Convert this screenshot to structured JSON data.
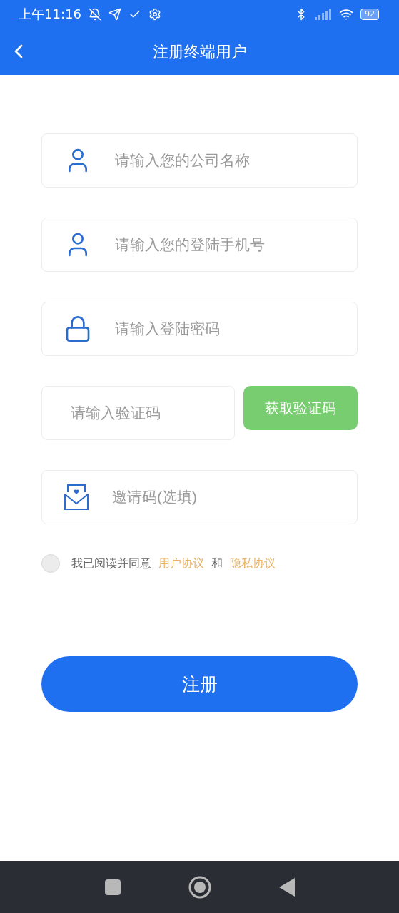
{
  "status_bar": {
    "time": "上午11:16",
    "battery": "92"
  },
  "nav": {
    "title": "注册终端用户"
  },
  "fields": [
    {
      "kind": "person",
      "placeholder": "请输入您的公司名称"
    },
    {
      "kind": "person",
      "placeholder": "请输入您的登陆手机号"
    },
    {
      "kind": "lock",
      "placeholder": "请输入登陆密码"
    },
    {
      "kind": "code",
      "placeholder": "请输入验证码",
      "button": "获取验证码"
    },
    {
      "kind": "envelope",
      "placeholder": "邀请码(选填)"
    }
  ],
  "agreement": {
    "checked": false,
    "text": "我已阅读并同意",
    "link_1": "用户协议",
    "joiner": "和",
    "link_2": "隐私协议"
  },
  "submit": "注册"
}
